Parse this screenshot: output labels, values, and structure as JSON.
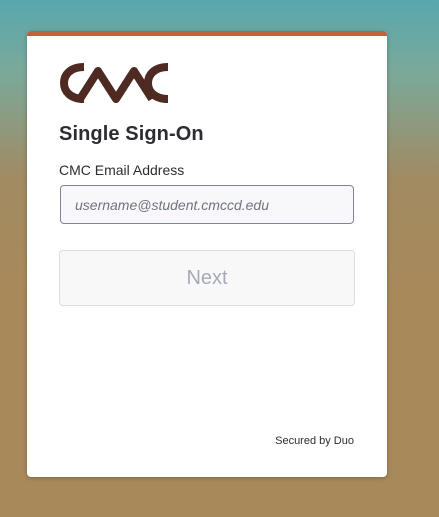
{
  "brand": {
    "logo_text": "CMC",
    "logo_color": "#4e2a22",
    "accent_color": "#c1613f"
  },
  "login": {
    "title": "Single Sign-On",
    "email_label": "CMC Email Address",
    "email_placeholder": "username@student.cmccd.edu",
    "email_value": "",
    "next_label": "Next"
  },
  "footer": {
    "secured_by": "Secured by Duo"
  }
}
